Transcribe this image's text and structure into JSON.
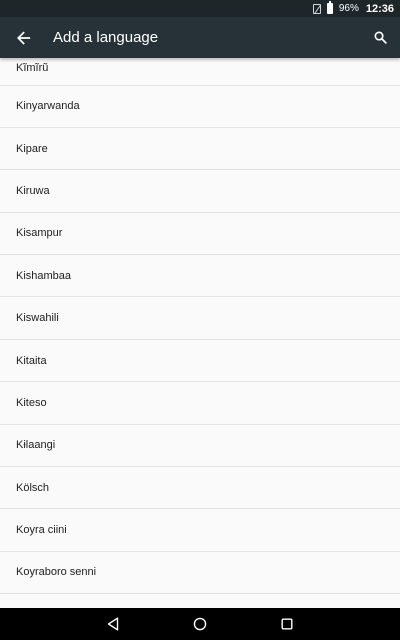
{
  "status_bar": {
    "battery_percent": "96%",
    "time": "12:36"
  },
  "app_bar": {
    "title": "Add a language",
    "back_icon": "arrow-back-icon",
    "search_icon": "search-icon"
  },
  "languages": [
    "Kĩmĩrũ",
    "Kinyarwanda",
    "Kipare",
    "Kiruwa",
    "Kisampur",
    "Kishambaa",
    "Kiswahili",
    "Kitaita",
    "Kiteso",
    "Kɨlaangi",
    "Kölsch",
    "Koyra ciini",
    "Koyraboro senni"
  ],
  "nav_bar": {
    "back_icon": "nav-back-triangle-icon",
    "home_icon": "nav-home-circle-icon",
    "recents_icon": "nav-recents-square-icon"
  },
  "colors": {
    "status_bar": "#1e262a",
    "app_bar": "#263238",
    "list_background": "#fafafa",
    "divider": "#e3e3e3",
    "text": "#212121"
  }
}
